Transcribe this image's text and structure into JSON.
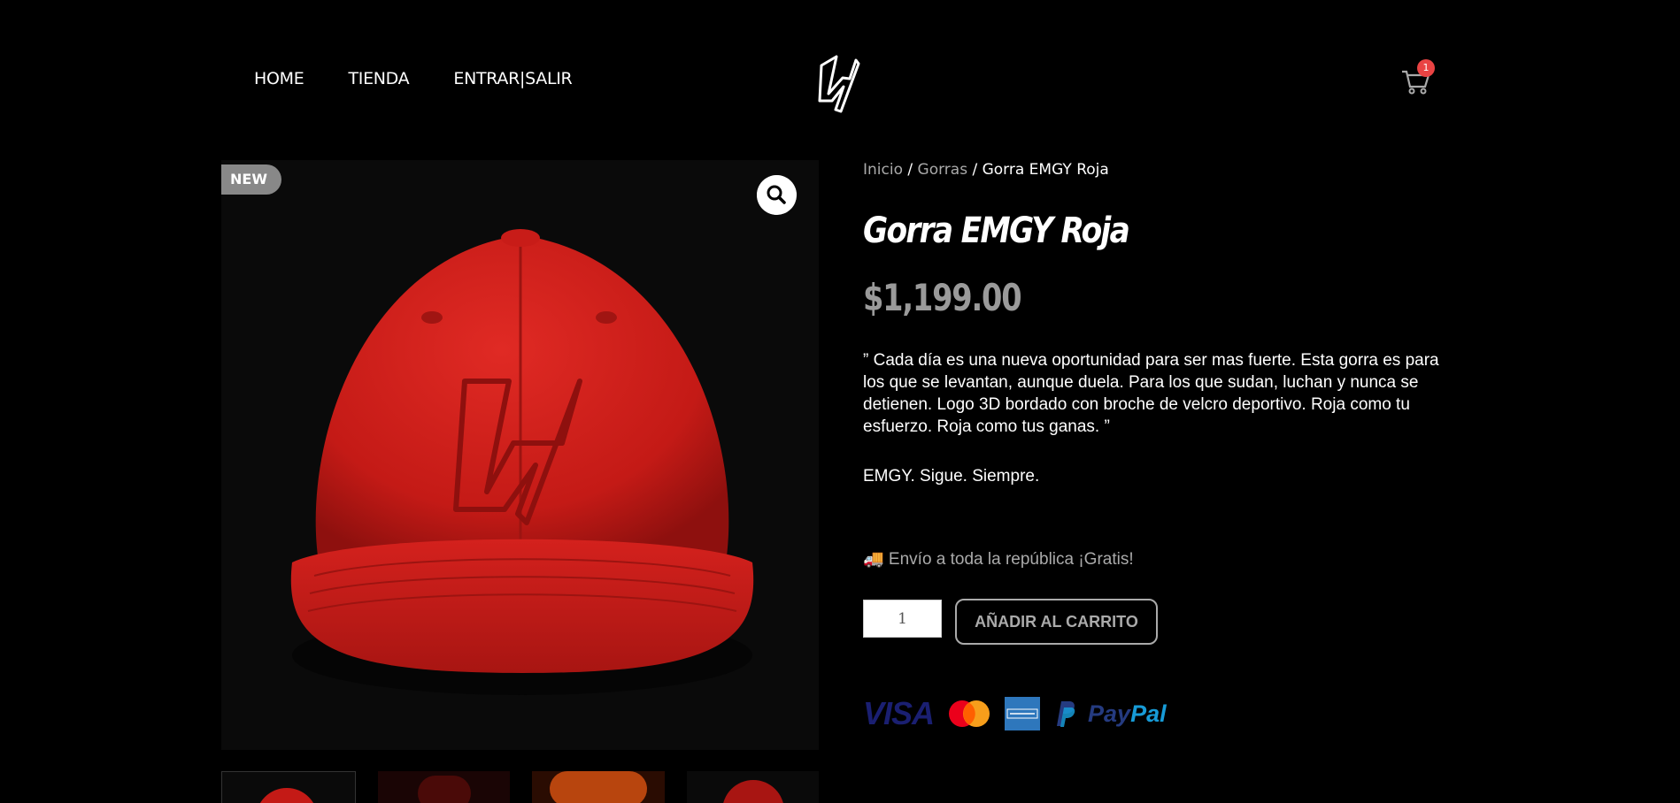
{
  "nav": {
    "items": [
      "HOME",
      "TIENDA",
      "ENTRAR|SALIR"
    ]
  },
  "cart": {
    "count": "1"
  },
  "product": {
    "badge": "NEW",
    "breadcrumb": {
      "home": "Inicio",
      "category": "Gorras",
      "current": "Gorra EMGY Roja"
    },
    "title": "Gorra EMGY Roja",
    "price": "$1,199.00",
    "description": "” Cada día es una nueva oportunidad para ser mas fuerte. Esta gorra es para los que se levantan, aunque duela. Para los que sudan, luchan y nunca se detienen. Logo 3D bordado con broche de velcro deportivo. Roja como tu esfuerzo. Roja como tus ganas. ”",
    "tagline": "EMGY. Sigue. Siempre.",
    "shipping": "🚚 Envío a toda la república ¡Gratis!",
    "quantity": "1",
    "add_to_cart": "AÑADIR AL CARRITO"
  },
  "payments": {
    "visa": "VISA",
    "paypal_a": "Pay",
    "paypal_b": "Pal"
  },
  "colors": {
    "accent_red": "#d81f1c",
    "badge_red": "#e94343",
    "price_gray": "#9a9a9a"
  },
  "icons": [
    "logo-icon",
    "cart-icon",
    "zoom-icon",
    "truck-icon",
    "visa-icon",
    "mastercard-icon",
    "amex-icon",
    "paypal-icon"
  ]
}
